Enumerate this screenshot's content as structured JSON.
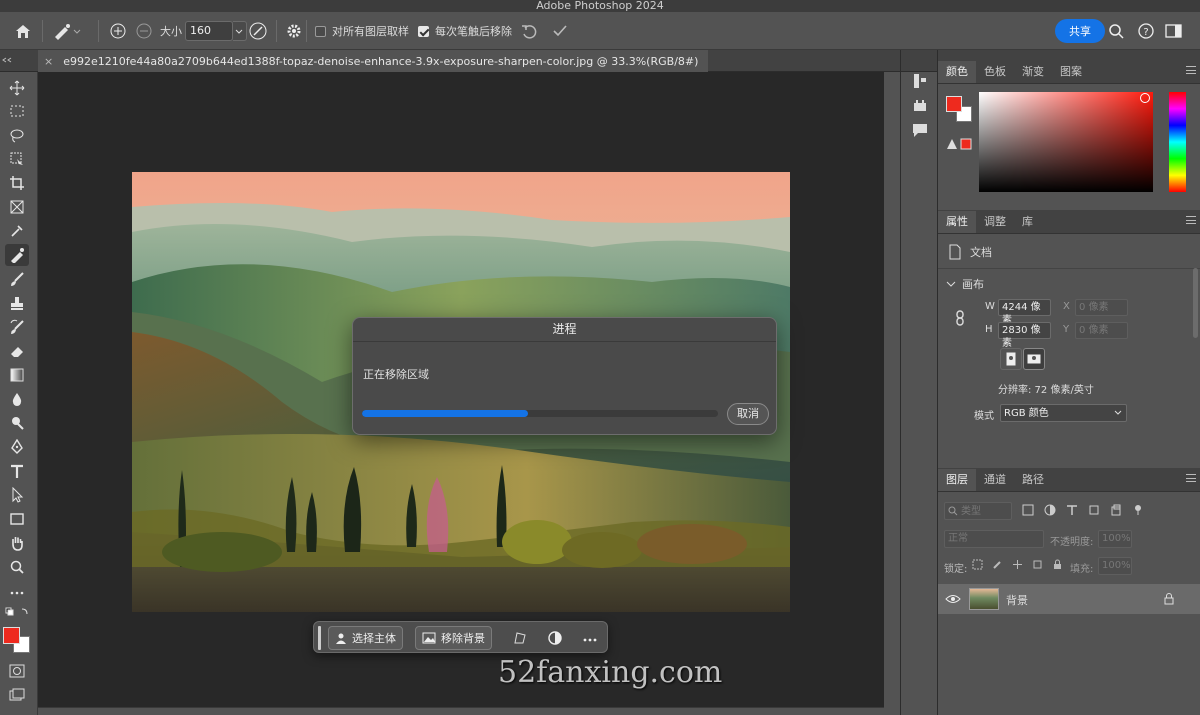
{
  "app": {
    "title": "Adobe Photoshop 2024"
  },
  "options": {
    "size_label": "大小",
    "size_value": "160",
    "sample_all_label": "对所有图层取样",
    "remove_after_label": "每次笔触后移除",
    "share_label": "共享"
  },
  "document": {
    "tab_title": "e992e1210fe44a80a2709b644ed1388f-topaz-denoise-enhance-3.9x-exposure-sharpen-color.jpg @ 33.3%(RGB/8#)"
  },
  "dialog": {
    "title": "进程",
    "message": "正在移除区域",
    "progress": 0.465,
    "cancel_label": "取消"
  },
  "taskbar": {
    "select_subject": "选择主体",
    "remove_background": "移除背景"
  },
  "watermark": "52fanxing.com",
  "color_panel": {
    "tabs": [
      "颜色",
      "色板",
      "渐变",
      "图案"
    ],
    "foreground": "#ee2a1e",
    "background": "#ffffff"
  },
  "properties_panel": {
    "tabs": [
      "属性",
      "调整",
      "库"
    ],
    "doc_label": "文档",
    "canvas_label": "画布",
    "w_label": "W",
    "w_value": "4244 像素",
    "h_label": "H",
    "h_value": "2830 像素",
    "x_label": "X",
    "x_value": "0 像素",
    "y_label": "Y",
    "y_value": "0 像素",
    "resolution": "分辨率: 72 像素/英寸",
    "mode_label": "模式",
    "mode_value": "RGB 颜色"
  },
  "layers_panel": {
    "tabs": [
      "图层",
      "通道",
      "路径"
    ],
    "filter_kind": "类型",
    "blend_mode": "正常",
    "opacity_label": "不透明度:",
    "opacity_value": "100%",
    "lock_label": "锁定:",
    "fill_label": "填充:",
    "fill_value": "100%",
    "layer_name": "背景"
  }
}
